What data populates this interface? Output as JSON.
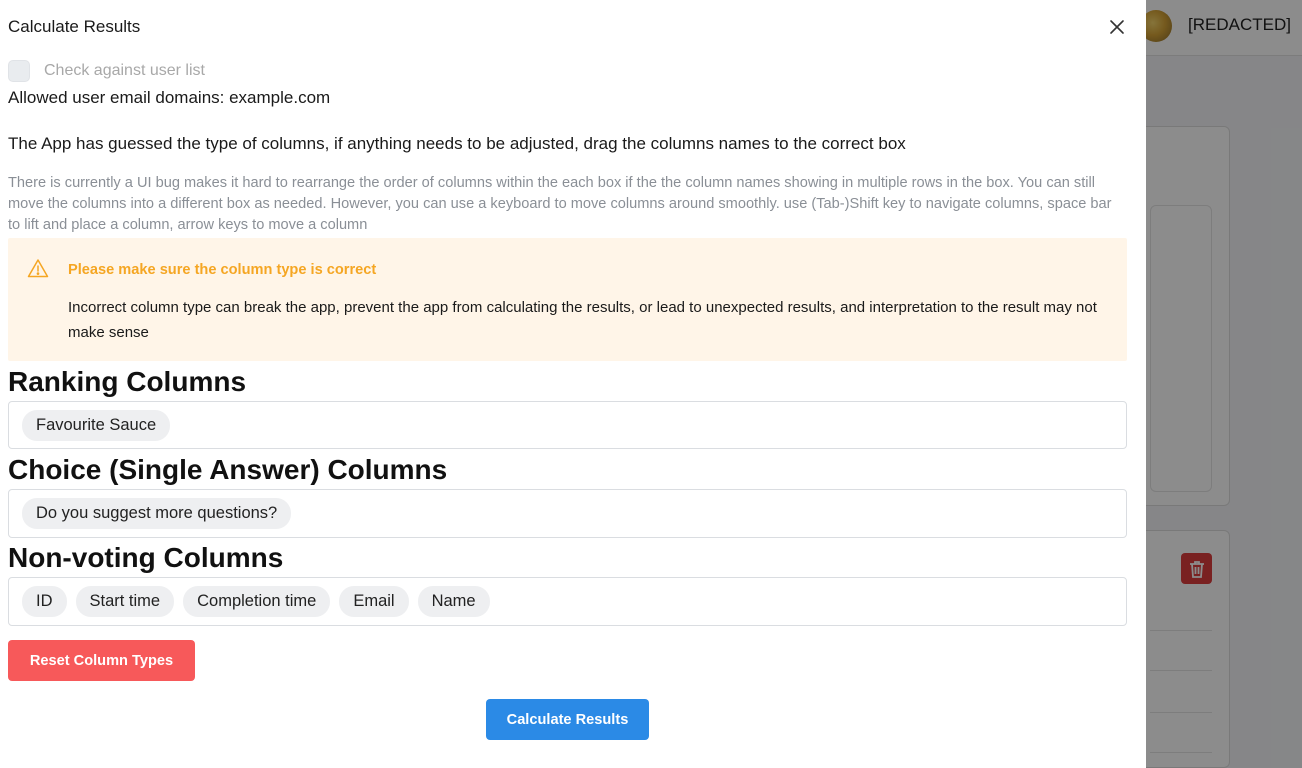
{
  "drawer": {
    "title": "Calculate Results",
    "close_icon": "close-icon",
    "check_against_label": "Check against user list",
    "allowed_domains": "Allowed user email domains: example.com",
    "guess_text": "The App has guessed the type of columns, if anything needs to be adjusted, drag the columns names to the correct box",
    "bug_text": "There is currently a UI bug makes it hard to rearrange the order of columns within the each box if the the column names showing in multiple rows in the box. You can still move the columns into a different box as needed. However, you can use a keyboard to move columns around smoothly. use (Tab-)Shift key to navigate columns, space bar to lift and place a column, arrow keys to move a column",
    "alert": {
      "icon": "warning-icon",
      "title": "Please make sure the column type is correct",
      "body": "Incorrect column type can break the app, prevent the app from calculating the results, or lead to unexpected results, and interpretation to the result may not make sense",
      "accent": "#f5a623"
    },
    "sections": {
      "ranking": {
        "title": "Ranking Columns",
        "items": [
          "Favourite Sauce"
        ]
      },
      "choice": {
        "title": "Choice (Single Answer) Columns",
        "items": [
          "Do you suggest more questions?"
        ]
      },
      "nonvoting": {
        "title": "Non-voting Columns",
        "items": [
          "ID",
          "Start time",
          "Completion time",
          "Email",
          "Name"
        ]
      }
    },
    "reset_button": "Reset Column Types",
    "calculate_button": "Calculate Results"
  },
  "background": {
    "user_name": "[REDACTED]",
    "trash_icon": "trash-icon"
  },
  "colors": {
    "reset": "#f7595a",
    "primary": "#2b8ae6",
    "warning_bg": "#fff5e8"
  }
}
